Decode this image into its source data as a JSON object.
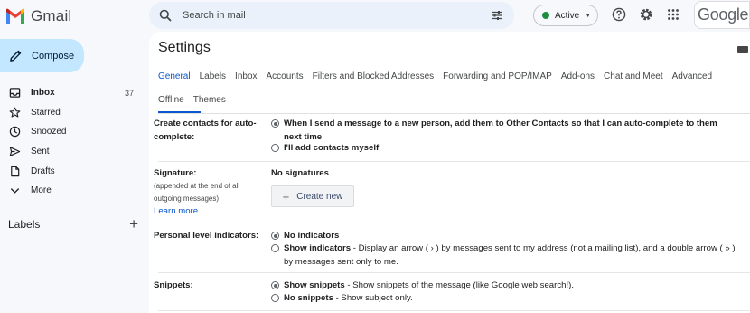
{
  "app": {
    "name": "Gmail",
    "brand_colors": {
      "red": "#ea4335",
      "blue": "#4285f4",
      "green": "#34a853",
      "yellow": "#fbbc04"
    }
  },
  "compose": {
    "label": "Compose",
    "icon": "pencil-icon"
  },
  "nav": {
    "items": [
      {
        "label": "Inbox",
        "count": "37",
        "icon": "inbox-icon",
        "bold": true
      },
      {
        "label": "Starred",
        "icon": "star-icon"
      },
      {
        "label": "Snoozed",
        "icon": "clock-icon"
      },
      {
        "label": "Sent",
        "icon": "send-icon"
      },
      {
        "label": "Drafts",
        "icon": "draft-icon"
      },
      {
        "label": "More",
        "icon": "chevron-down-icon"
      }
    ]
  },
  "labels": {
    "heading": "Labels",
    "add_icon": "plus-icon"
  },
  "search": {
    "placeholder": "Search in mail"
  },
  "status": {
    "label": "Active",
    "color": "#1e8e3e"
  },
  "topbar_icons": [
    "help-icon",
    "gear-icon",
    "apps-grid-icon"
  ],
  "account": {
    "label": "Google"
  },
  "settings": {
    "title": "Settings",
    "tabs_row1": [
      "General",
      "Labels",
      "Inbox",
      "Accounts",
      "Filters and Blocked Addresses",
      "Forwarding and POP/IMAP",
      "Add-ons",
      "Chat and Meet",
      "Advanced"
    ],
    "tabs_row2": [
      "Offline",
      "Themes"
    ],
    "active_tab": "General",
    "accent": "#0b57d0",
    "sections": {
      "create_contacts": {
        "label_line1": "Create contacts for auto-",
        "label_line2": "complete:",
        "option1_line1": "When I send a message to a new person, add them to Other Contacts so that I can auto-complete to them",
        "option1_line2": "next time",
        "option2": "I'll add contacts myself",
        "selected": 1
      },
      "signature": {
        "label": "Signature:",
        "sub_line1": "(appended at the end of all",
        "sub_line2": "outgoing messages)",
        "learn_more": "Learn more",
        "value": "No signatures",
        "create_button": "Create new"
      },
      "personal_level": {
        "label": "Personal level indicators:",
        "option1": "No indicators",
        "option2_title": "Show indicators",
        "option2_desc_line1": " - Display an arrow ( › ) by messages sent to my address (not a mailing list), and a double arrow ( » )",
        "option2_desc_line2": "by messages sent only to me.",
        "selected": 1
      },
      "snippets": {
        "label": "Snippets:",
        "option1_title": "Show snippets",
        "option1_desc": " - Show snippets of the message (like Google web search!).",
        "option2_title": "No snippets",
        "option2_desc": " - Show subject only.",
        "selected": 1
      }
    }
  }
}
